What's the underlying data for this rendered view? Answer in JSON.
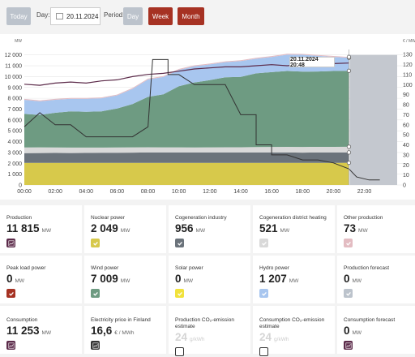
{
  "toolbar": {
    "today": "Today",
    "day_label": "Day:",
    "date_value": "20.11.2024",
    "period_label": "Period:",
    "day": "Day",
    "week": "Week",
    "month": "Month"
  },
  "chart": {
    "y_left_unit": "MW",
    "y_right_unit": "€ / MWh",
    "tooltip": "20.11.2024 20:48"
  },
  "chart_data": {
    "type": "area",
    "x_ticks": [
      "00:00",
      "02:00",
      "04:00",
      "06:00",
      "08:00",
      "10:00",
      "12:00",
      "14:00",
      "16:00",
      "18:00",
      "20:00",
      "22:00"
    ],
    "y_left_ticks": [
      "0",
      "1 000",
      "2 000",
      "3 000",
      "4 000",
      "5 000",
      "6 000",
      "7 000",
      "8 000",
      "9 000",
      "10 000",
      "11 000",
      "12 000"
    ],
    "y_right_ticks": [
      "0",
      "10",
      "20",
      "30",
      "40",
      "50",
      "60",
      "70",
      "80",
      "90",
      "100",
      "110",
      "120",
      "130"
    ],
    "ylim_left": [
      0,
      12500
    ],
    "ylim_right": [
      0,
      135
    ],
    "x_hours": [
      0,
      1,
      2,
      3,
      4,
      5,
      6,
      7,
      8,
      9,
      10,
      11,
      12,
      13,
      14,
      15,
      16,
      17,
      18,
      19,
      20,
      21
    ],
    "series": [
      {
        "name": "Nuclear power",
        "color": "#d7c94b",
        "values": [
          2040,
          2040,
          2040,
          2040,
          2040,
          2040,
          2040,
          2040,
          2040,
          2040,
          2040,
          2040,
          2040,
          2040,
          2040,
          2040,
          2040,
          2040,
          2040,
          2040,
          2040,
          2049
        ]
      },
      {
        "name": "Cogeneration industry",
        "color": "#6b737b",
        "values": [
          900,
          910,
          920,
          910,
          920,
          930,
          940,
          950,
          960,
          960,
          960,
          960,
          960,
          960,
          960,
          960,
          960,
          960,
          950,
          960,
          960,
          956
        ]
      },
      {
        "name": "Cogeneration district heating",
        "color": "#d9d9d9",
        "values": [
          520,
          520,
          500,
          500,
          490,
          480,
          480,
          480,
          480,
          470,
          470,
          460,
          470,
          480,
          480,
          500,
          510,
          520,
          520,
          520,
          520,
          521
        ]
      },
      {
        "name": "Wind power",
        "color": "#6e9b82",
        "values": [
          3100,
          3000,
          3200,
          3350,
          3300,
          3350,
          3600,
          4000,
          4650,
          4900,
          5650,
          6000,
          6200,
          6450,
          6500,
          6800,
          6900,
          7000,
          6950,
          6950,
          7000,
          7009
        ]
      },
      {
        "name": "Hydro power",
        "color": "#a8c6ef",
        "values": [
          1300,
          1250,
          1200,
          1150,
          1200,
          1200,
          1200,
          1400,
          1600,
          1600,
          1500,
          1500,
          1450,
          1400,
          1450,
          1350,
          1400,
          1500,
          1550,
          1450,
          1300,
          1207
        ]
      },
      {
        "name": "Other production",
        "color": "#e3bcc2",
        "values": [
          80,
          80,
          80,
          80,
          80,
          80,
          80,
          80,
          80,
          80,
          80,
          80,
          80,
          80,
          80,
          80,
          80,
          80,
          80,
          80,
          80,
          73
        ]
      }
    ],
    "lines": [
      {
        "name": "Consumption",
        "color": "#5c2b4a",
        "values": [
          9300,
          9200,
          9400,
          9500,
          9400,
          9600,
          9700,
          10000,
          10200,
          10300,
          10500,
          10700,
          10800,
          10900,
          10900,
          11000,
          11100,
          11000,
          11100,
          11300,
          11200,
          11253
        ]
      },
      {
        "name": "Electricity price in Finland",
        "color": "#333333",
        "axis": "right",
        "step_points": [
          [
            0,
            58
          ],
          [
            1,
            72
          ],
          [
            2,
            60
          ],
          [
            3,
            60
          ],
          [
            4,
            48
          ],
          [
            5,
            48
          ],
          [
            6,
            48
          ],
          [
            7,
            48
          ],
          [
            8,
            58
          ],
          [
            8.3,
            125
          ],
          [
            9.3,
            125
          ],
          [
            9.3,
            110
          ],
          [
            10,
            110
          ],
          [
            11,
            100
          ],
          [
            12,
            100
          ],
          [
            13,
            100
          ],
          [
            14,
            70
          ],
          [
            15,
            70
          ],
          [
            15,
            40
          ],
          [
            16,
            40
          ],
          [
            16,
            30
          ],
          [
            17,
            30
          ],
          [
            18,
            25
          ],
          [
            19,
            25
          ],
          [
            20,
            22
          ],
          [
            21,
            16
          ],
          [
            21.5,
            8
          ],
          [
            22.3,
            5
          ],
          [
            23,
            5
          ]
        ]
      }
    ]
  },
  "cards": [
    {
      "title": "Production",
      "value": "11 815",
      "unit": "MW",
      "icon": "chart-icon",
      "color": "#5c2b4a",
      "grey": false
    },
    {
      "title": "Nuclear power",
      "value": "2 049",
      "unit": "MW",
      "icon": "check-icon",
      "color": "#d7c94b",
      "grey": false
    },
    {
      "title": "Cogeneration industry",
      "value": "956",
      "unit": "MW",
      "icon": "check-icon",
      "color": "#6b737b",
      "grey": false
    },
    {
      "title": "Cogeneration district heating",
      "value": "521",
      "unit": "MW",
      "icon": "check-icon",
      "color": "#d9d9d9",
      "grey": false
    },
    {
      "title": "Other production",
      "value": "73",
      "unit": "MW",
      "icon": "check-icon",
      "color": "#e3bcc2",
      "grey": false
    },
    {
      "title": "Peak load power",
      "value": "0",
      "unit": "MW",
      "icon": "check-icon",
      "color": "#a63223",
      "grey": false
    },
    {
      "title": "Wind power",
      "value": "7 009",
      "unit": "MW",
      "icon": "check-icon",
      "color": "#6e9b82",
      "grey": false
    },
    {
      "title": "Solar power",
      "value": "0",
      "unit": "MW",
      "icon": "check-icon",
      "color": "#f1e23c",
      "grey": false
    },
    {
      "title": "Hydro power",
      "value": "1 207",
      "unit": "MW",
      "icon": "check-icon",
      "color": "#a8c6ef",
      "grey": false
    },
    {
      "title": "Production forecast",
      "value": "0",
      "unit": "MW",
      "icon": "check-icon",
      "color": "#bcc3cc",
      "grey": false
    },
    {
      "title": "Consumption",
      "value": "11 253",
      "unit": "MW",
      "icon": "chart-icon",
      "color": "#5c2b4a",
      "grey": false
    },
    {
      "title": "Electricity price in Finland",
      "value": "16,6",
      "unit": "€ / MWh",
      "icon": "chart-icon",
      "color": "#333333",
      "grey": false
    },
    {
      "title": "Production CO₂-emission estimate",
      "value": "24",
      "unit": "g/kWh",
      "icon": "empty-checkbox-icon",
      "color": "#333333",
      "grey": true
    },
    {
      "title": "Consumption CO₂-emission estimate",
      "value": "24",
      "unit": "g/kWh",
      "icon": "empty-checkbox-icon",
      "color": "#333333",
      "grey": true
    },
    {
      "title": "Consumption forecast",
      "value": "0",
      "unit": "MW",
      "icon": "chart-icon",
      "color": "#5c2b4a",
      "grey": false
    }
  ]
}
